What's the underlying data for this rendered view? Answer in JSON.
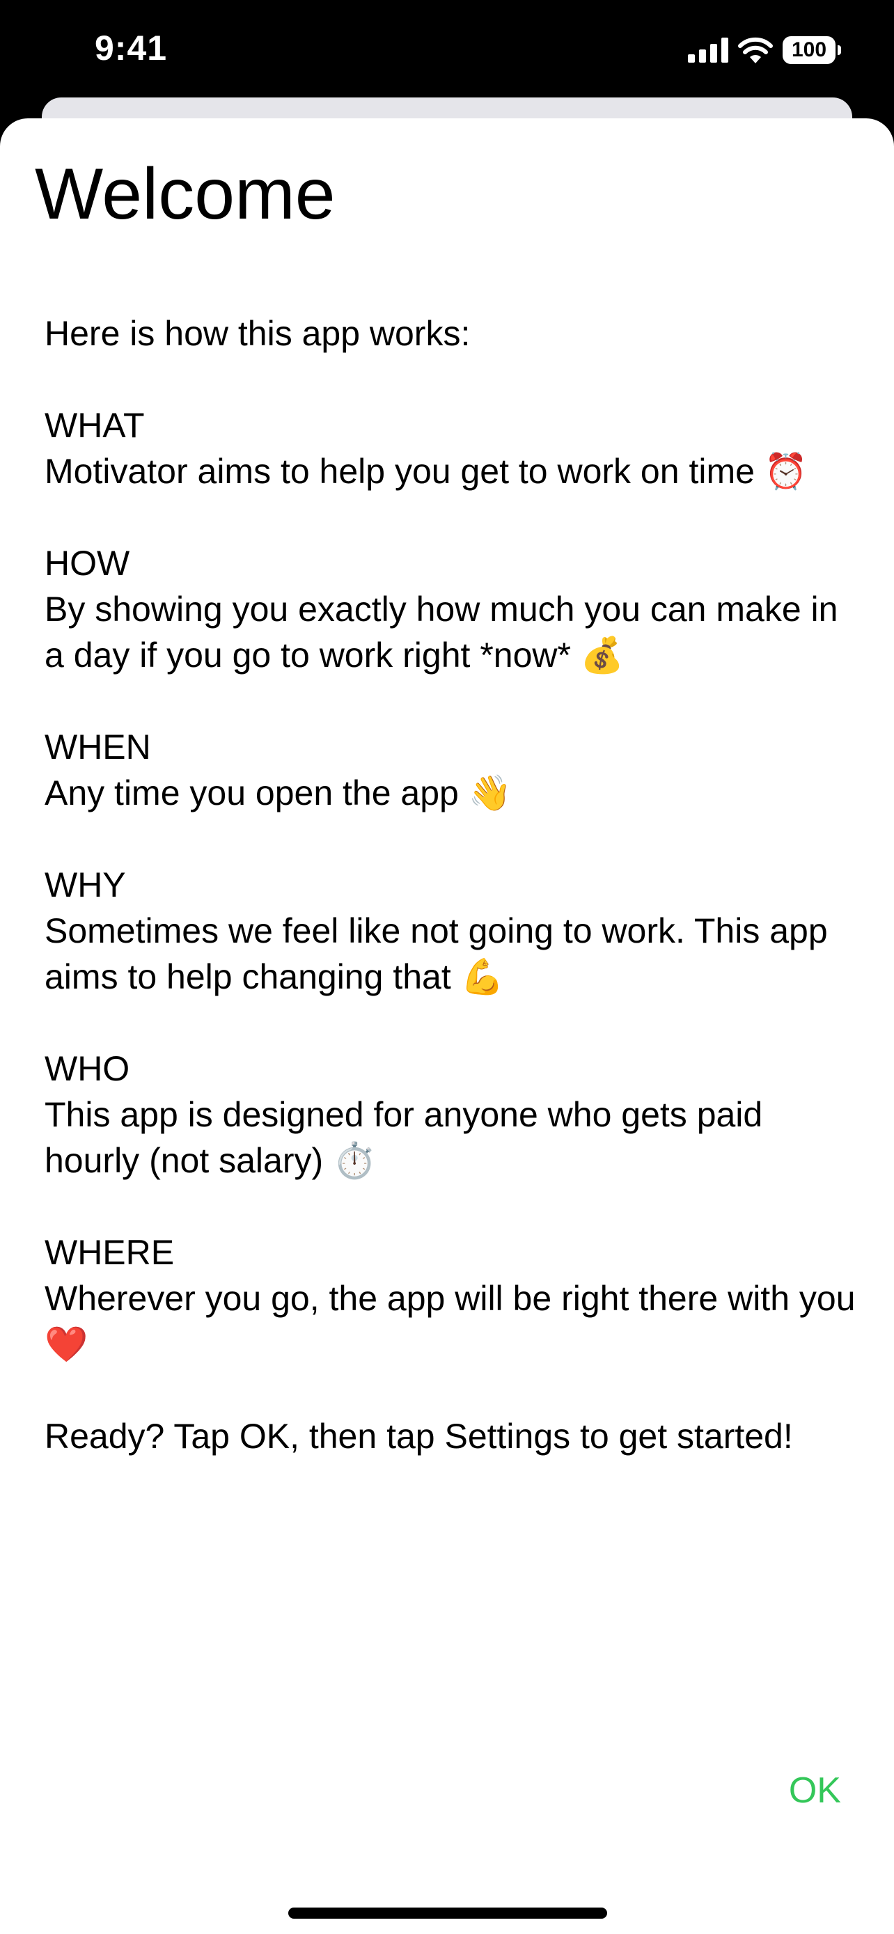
{
  "status_bar": {
    "time": "9:41",
    "battery": "100",
    "icons": [
      "signal-icon",
      "wifi-icon",
      "battery-icon"
    ]
  },
  "sheet": {
    "title": "Welcome",
    "intro": "Here is how this app works:",
    "sections": [
      {
        "heading": "WHAT",
        "body": "Motivator aims to help you get to work on time ⏰"
      },
      {
        "heading": "HOW",
        "body": "By showing you exactly how much you can make in a day if you go to work right *now* 💰"
      },
      {
        "heading": "WHEN",
        "body": "Any time you open the app 👋"
      },
      {
        "heading": "WHY",
        "body": "Sometimes we feel like not going to work. This app aims to help changing that 💪"
      },
      {
        "heading": "WHO",
        "body": "This app is designed for anyone who gets paid hourly (not salary) ⏱️"
      },
      {
        "heading": "WHERE",
        "body": "Wherever you go, the app will be right there with you ❤️"
      }
    ],
    "closing": "Ready? Tap OK, then tap Settings to get started!",
    "ok_label": "OK"
  },
  "colors": {
    "accent": "#34c759",
    "background": "#ffffff",
    "status_bar": "#000000"
  }
}
